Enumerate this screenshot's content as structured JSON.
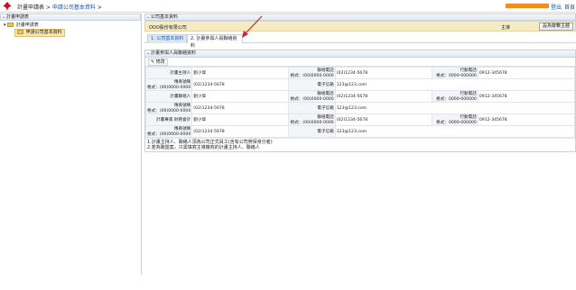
{
  "header": {
    "breadcrumb": [
      "計畫申請表",
      "申請公司基本資料"
    ],
    "separator": ">",
    "user_links": [
      "登出",
      "首頁"
    ]
  },
  "left_panel": {
    "title": "計畫申請表",
    "tree_root": "計畫申請表",
    "tree_child": "申請公司基本資料"
  },
  "company_panel": {
    "title": "公司基本資料",
    "company_name": "OOO股份有限公司",
    "role": "主導",
    "contact_button": "設為聯繫主體"
  },
  "tabs": [
    {
      "label": "1. 公司基本資料"
    },
    {
      "label": "2. 計畫參與人員聯絡資料"
    }
  ],
  "contacts_panel": {
    "title": "計畫參與人員聯絡資料",
    "edit_button": "修改",
    "rows": [
      {
        "role": "計畫主持人",
        "name": "劉小偉",
        "phone_label": "聯絡電話",
        "phone_fmt": "格式：(00)0000-0000",
        "phone": "(02)1234-5678",
        "mobile_label": "行動電話",
        "mobile_fmt": "格式：0000-000000",
        "mobile": "0912-345678",
        "fax_label": "傳真號碼",
        "fax_fmt": "格式：(00)0000-0000",
        "fax": "(02)1234-5678",
        "email_label": "電子信箱",
        "email": "123@123.com"
      },
      {
        "role": "計畫聯絡人",
        "name": "劉小偉",
        "phone_label": "聯絡電話",
        "phone_fmt": "格式：(00)0000-0000",
        "phone": "(02)1234-5678",
        "mobile_label": "行動電話",
        "mobile_fmt": "格式：0000-000000",
        "mobile": "0912-345678",
        "fax_label": "傳真號碼",
        "fax_fmt": "格式：(00)0000-0000",
        "fax": "(02)1234-5678",
        "email_label": "電子信箱",
        "email": "123@123.com"
      },
      {
        "role": "計畫專責 財務會計",
        "name": "劉小偉",
        "phone_label": "聯絡電話",
        "phone_fmt": "格式：(00)0000-0000",
        "phone": "(02)1234-5678",
        "mobile_label": "行動電話",
        "mobile_fmt": "格式：0000-000000",
        "mobile": "0912-345678",
        "fax_label": "傳真號碼",
        "fax_fmt": "格式：(00)0000-0000",
        "fax": "(02)1234-5678",
        "email_label": "電子信箱",
        "email": "123@123.com"
      }
    ],
    "notes": [
      "1.計畫主持人、聯絡人須為公司正式員工(含有公司勞保身分者)",
      "2.若為聯盟案，只需填寫主導廠商的計畫主持人、聯絡人"
    ]
  },
  "colors": {
    "accent": "#f28c1e",
    "link": "#1a5aa8",
    "highlight": "#f6ecc4",
    "arrow": "#d0242a"
  }
}
